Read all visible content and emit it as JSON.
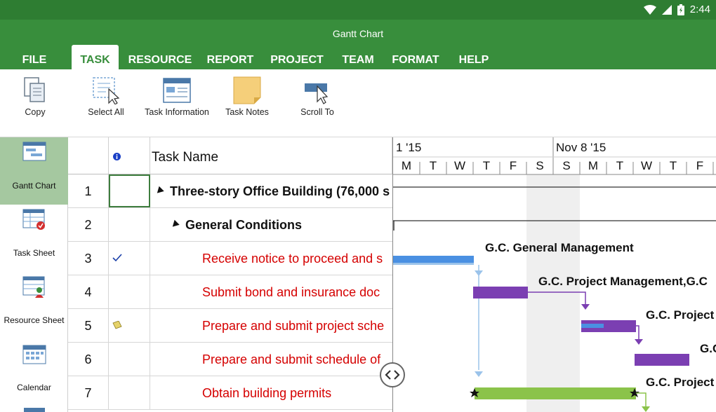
{
  "status": {
    "time": "2:44"
  },
  "app": {
    "title": "Gantt Chart"
  },
  "menu": [
    "FILE",
    "TASK",
    "RESOURCE",
    "REPORT",
    "PROJECT",
    "TEAM",
    "FORMAT",
    "HELP"
  ],
  "menu_active": "TASK",
  "ribbon": {
    "copy": "Copy",
    "select_all": "Select All",
    "task_information": "Task Information",
    "task_notes": "Task Notes",
    "scroll_to": "Scroll To"
  },
  "views": [
    "Gantt Chart",
    "Task Sheet",
    "Resource Sheet",
    "Calendar"
  ],
  "views_active": "Gantt Chart",
  "grid": {
    "task_name_header": "Task Name",
    "rows": [
      {
        "id": "1",
        "name": "Three-story Office Building (76,000 s",
        "type": "summary",
        "level": 0,
        "indicator": ""
      },
      {
        "id": "2",
        "name": "General Conditions",
        "type": "summary",
        "level": 1,
        "indicator": ""
      },
      {
        "id": "3",
        "name": "Receive notice to proceed and s",
        "type": "task",
        "level": 2,
        "indicator": "check-icon"
      },
      {
        "id": "4",
        "name": "Submit bond and insurance doc",
        "type": "task",
        "level": 2,
        "indicator": ""
      },
      {
        "id": "5",
        "name": "Prepare and submit project sche",
        "type": "task",
        "level": 2,
        "indicator": "note-icon"
      },
      {
        "id": "6",
        "name": "Prepare and submit schedule of",
        "type": "task",
        "level": 2,
        "indicator": ""
      },
      {
        "id": "7",
        "name": "Obtain building permits",
        "type": "task",
        "level": 2,
        "indicator": ""
      }
    ]
  },
  "timescale": {
    "weeks": [
      "1 '15",
      "Nov 8 '15"
    ],
    "days": [
      "M",
      "T",
      "W",
      "T",
      "F",
      "S",
      "S",
      "M",
      "T",
      "W",
      "T",
      "F"
    ]
  },
  "gantt": {
    "labels": [
      "G.C. General Management",
      "G.C. Project Management,G.C",
      "G.C. Project",
      "G.C",
      "G.C. Project"
    ]
  },
  "colors": {
    "status_bar": "#2e7d32",
    "app_bar": "#388e3c",
    "critical_text": "#d50000",
    "bar_blue": "#4a90e2",
    "bar_purple": "#7b3fb2",
    "bar_green": "#8bc34a",
    "active_view": "#a5c8a0"
  }
}
